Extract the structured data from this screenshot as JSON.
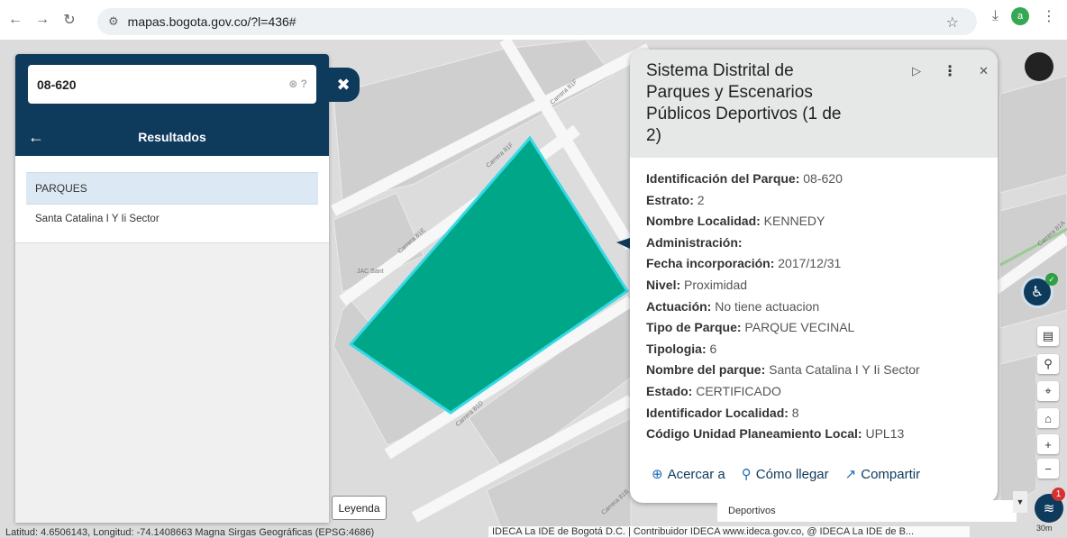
{
  "browser": {
    "url": "mapas.bogota.gov.co/?l=436#",
    "profile_initial": "a"
  },
  "search": {
    "value": "08-620"
  },
  "results": {
    "title": "Resultados",
    "category": "PARQUES",
    "items": [
      "Santa Catalina I Y Ii Sector"
    ]
  },
  "popup": {
    "title": "Sistema Distrital de Parques y Escenarios Públicos Deportivos (1 de 2)",
    "fields": [
      {
        "label": "Identificación del Parque:",
        "value": " 08-620"
      },
      {
        "label": "Estrato:",
        "value": " 2"
      },
      {
        "label": "Nombre Localidad:",
        "value": " KENNEDY"
      },
      {
        "label": "Administración:",
        "value": ""
      },
      {
        "label": "Fecha incorporación:",
        "value": " 2017/12/31"
      },
      {
        "label": "Nivel:",
        "value": " Proximidad"
      },
      {
        "label": "Actuación:",
        "value": " No tiene actuacion"
      },
      {
        "label": "Tipo de Parque:",
        "value": " PARQUE VECINAL"
      },
      {
        "label": "Tipologia:",
        "value": " 6"
      },
      {
        "label": "Nombre del parque:",
        "value": " Santa Catalina I Y Ii Sector"
      },
      {
        "label": "Estado:",
        "value": " CERTIFICADO"
      },
      {
        "label": "Identificador Localidad:",
        "value": " 8"
      },
      {
        "label": "Código Unidad Planeamiento Local:",
        "value": " UPL13"
      }
    ],
    "actions": {
      "zoom": "Acercar a",
      "directions": "Cómo llegar",
      "share": "Compartir"
    }
  },
  "map": {
    "streets": [
      "Carrera 81F",
      "Carrera 81F",
      "Carrera 81E",
      "Carrera 81D",
      "Carrera 81B",
      "Carrera 81A"
    ],
    "place_label": "JAC Sant",
    "legend_label": "Leyenda",
    "layer_select": "Deportivos",
    "layers_badge": "1",
    "coordinates": "Latitud: 4.6506143, Longitud: -74.1408663 Magna Sirgas Geográficas (EPSG:4686)",
    "attribution": "IDECA La IDE de Bogotá D.C. | Contribuidor IDECA www.ideca.gov.co, @ IDECA La IDE de B...",
    "scale": "30m",
    "park_color": "#00a688"
  }
}
